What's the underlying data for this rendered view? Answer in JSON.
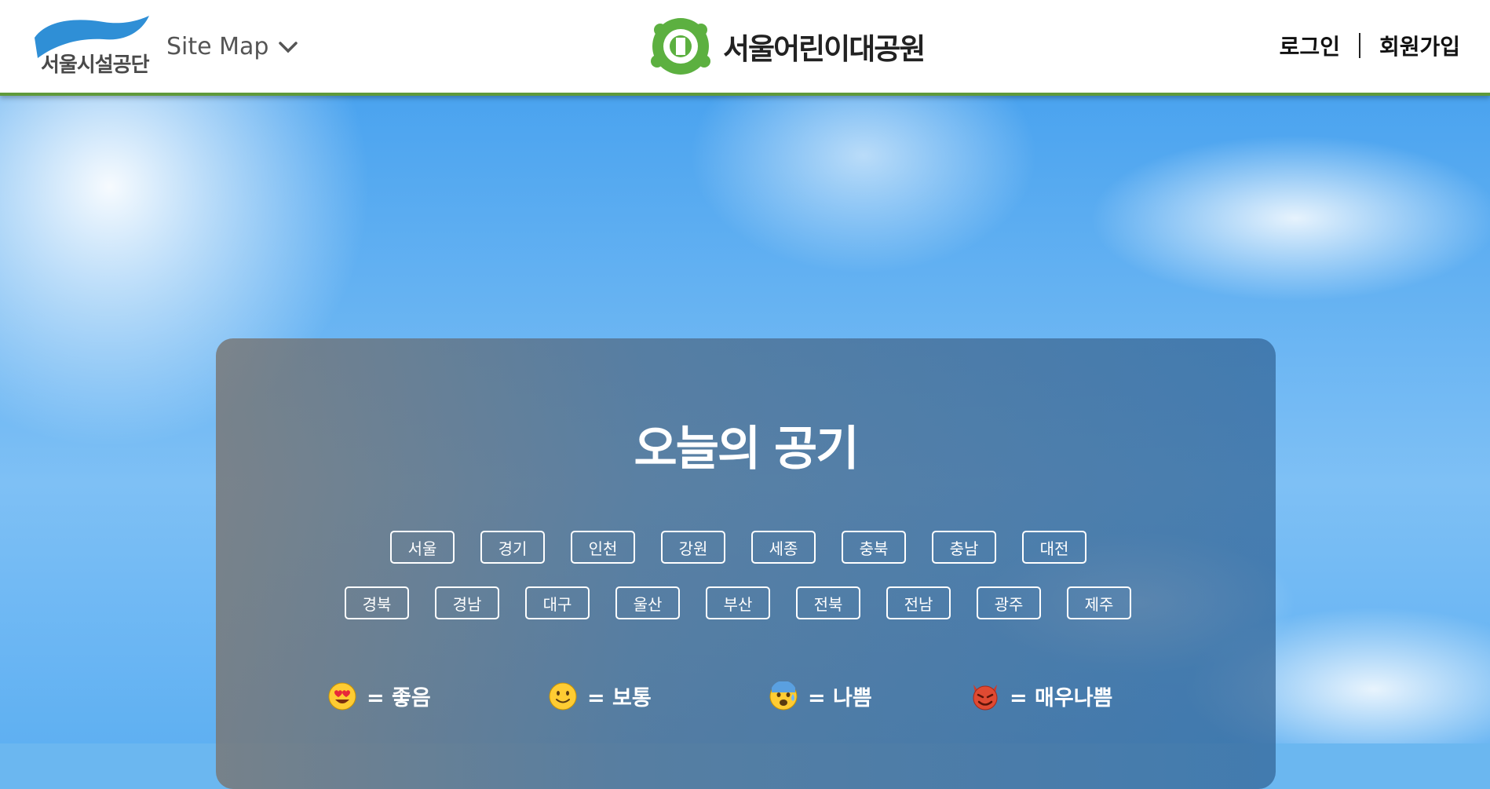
{
  "header": {
    "org_logo_text": "서울시설공단",
    "sitemap_label": "Site Map",
    "park_name": "서울어린이대공원",
    "login_label": "로그인",
    "signup_label": "회원가입"
  },
  "panel": {
    "title": "오늘의 공기",
    "regions_row1": [
      "서울",
      "경기",
      "인천",
      "강원",
      "세종",
      "충북",
      "충남",
      "대전"
    ],
    "regions_row2": [
      "경북",
      "경남",
      "대구",
      "울산",
      "부산",
      "전북",
      "전남",
      "광주",
      "제주"
    ],
    "legend": [
      {
        "icon": "heart-eyes-face-icon",
        "label": "= 좋음"
      },
      {
        "icon": "smiling-face-icon",
        "label": "= 보통"
      },
      {
        "icon": "anxious-sweat-face-icon",
        "label": "= 나쁨"
      },
      {
        "icon": "devil-face-icon",
        "label": "= 매우나쁨"
      }
    ]
  },
  "colors": {
    "header_border": "#5f9a3a",
    "logo_blue": "#2f8fd6",
    "park_green": "#5cb040"
  }
}
